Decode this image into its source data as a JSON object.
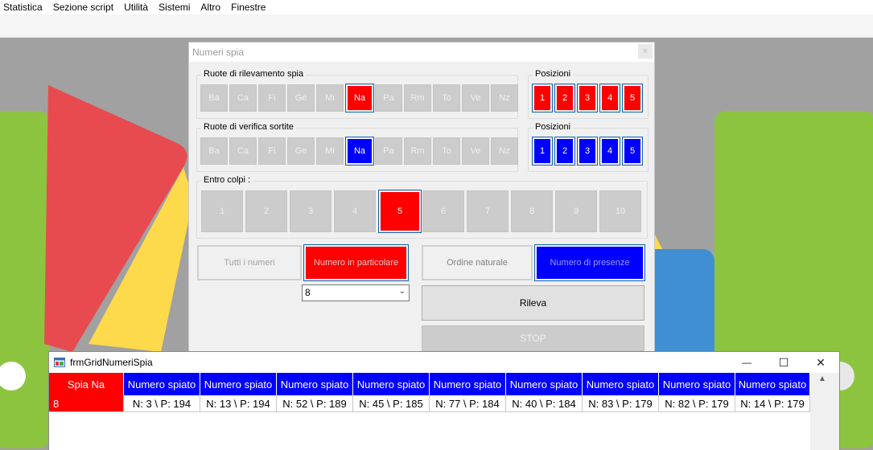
{
  "menubar": [
    "Statistica",
    "Sezione script",
    "Utilità",
    "Sistemi",
    "Altro",
    "Finestre"
  ],
  "dialog": {
    "title": "Numeri spia",
    "close": "×",
    "ruote_rilevamento": {
      "label": "Ruote di rilevamento spia",
      "wheels": [
        "Ba",
        "Ca",
        "Fi",
        "Ge",
        "Mi",
        "Na",
        "Pa",
        "Rm",
        "To",
        "Ve",
        "Nz"
      ],
      "selected": "Na"
    },
    "posizioni_rilevamento": {
      "label": "Posizioni",
      "items": [
        "1",
        "2",
        "3",
        "4",
        "5"
      ]
    },
    "ruote_verifica": {
      "label": "Ruote di verifica sortite",
      "wheels": [
        "Ba",
        "Ca",
        "Fi",
        "Ge",
        "Mi",
        "Na",
        "Pa",
        "Rm",
        "To",
        "Ve",
        "Nz"
      ],
      "selected": "Na"
    },
    "posizioni_verifica": {
      "label": "Posizioni",
      "items": [
        "1",
        "2",
        "3",
        "4",
        "5"
      ]
    },
    "entro_colpi": {
      "label": "Entro colpi :",
      "items": [
        "1",
        "2",
        "3",
        "4",
        "5",
        "6",
        "7",
        "8",
        "9",
        "10"
      ],
      "selected": "5"
    },
    "tutti_numeri": "Tutti i numeri",
    "numero_particolare": "Numero in particolare",
    "ordine_naturale": "Ordine naturale",
    "numero_presenze": "Numero di presenze",
    "combo_value": "8",
    "rileva": "Rileva",
    "stop": "STOP"
  },
  "grid_window": {
    "title": "frmGridNumeriSpia",
    "minimize": "—",
    "maximize": "☐",
    "close": "✕",
    "headers": [
      "Spia Na",
      "Numero spiato",
      "Numero spiato",
      "Numero spiato",
      "Numero spiato",
      "Numero spiato",
      "Numero spiato",
      "Numero spiato",
      "Numero spiato",
      "Numero spiato"
    ],
    "row": [
      "8",
      "N: 3 \\ P: 194",
      "N: 13 \\ P: 194",
      "N: 52 \\ P: 189",
      "N: 45 \\ P: 185",
      "N: 77 \\ P: 184",
      "N: 40 \\ P: 184",
      "N: 83 \\ P: 179",
      "N: 82 \\ P: 179",
      "N: 14 \\ P: 179"
    ],
    "scroll_up": "▲"
  },
  "colors": {
    "selected_red": "#ff0000",
    "selected_blue": "#0000ff",
    "disabled": "#cccccc"
  }
}
